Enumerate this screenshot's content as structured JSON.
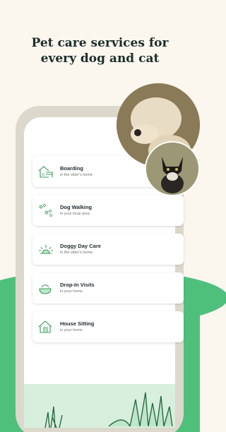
{
  "headline": {
    "line1": "Pet care services for",
    "line2": "every dog and cat"
  },
  "services": [
    {
      "title": "Boarding",
      "subtitle": "in the sitter's home",
      "icon": "house-bed-icon"
    },
    {
      "title": "Dog Walking",
      "subtitle": "in your local area",
      "icon": "paw-prints-icon"
    },
    {
      "title": "Doggy Day Care",
      "subtitle": "in the sitter's home",
      "icon": "sun-icon"
    },
    {
      "title": "Drop-In Visits",
      "subtitle": "in your home",
      "icon": "bowl-icon"
    },
    {
      "title": "House Sitting",
      "subtitle": "in your home",
      "icon": "house-icon"
    }
  ],
  "colors": {
    "accent": "#4fc07c",
    "background": "#fbf7ef",
    "text": "#1c2d2a"
  }
}
